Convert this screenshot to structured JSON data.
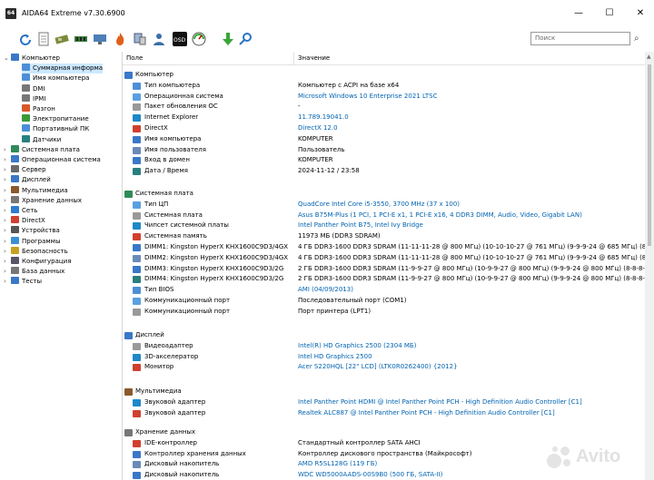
{
  "window": {
    "app_icon": "64",
    "title": "AIDA64 Extreme v7.30.6900",
    "minimize": "—",
    "maximize": "☐",
    "close": "✕"
  },
  "toolbar": {
    "search_placeholder": "Поиск"
  },
  "tree": {
    "items": [
      {
        "label": "Компьютер",
        "expanded": true,
        "level": 0
      },
      {
        "label": "Суммарная информа",
        "selected": true,
        "level": 1
      },
      {
        "label": "Имя компьютера",
        "level": 1
      },
      {
        "label": "DMI",
        "level": 1
      },
      {
        "label": "IPMI",
        "level": 1
      },
      {
        "label": "Разгон",
        "level": 1
      },
      {
        "label": "Электропитание",
        "level": 1
      },
      {
        "label": "Портативный ПК",
        "level": 1
      },
      {
        "label": "Датчики",
        "level": 1
      },
      {
        "label": "Системная плата",
        "level": 0
      },
      {
        "label": "Операционная система",
        "level": 0
      },
      {
        "label": "Сервер",
        "level": 0
      },
      {
        "label": "Дисплей",
        "level": 0
      },
      {
        "label": "Мультимедиа",
        "level": 0
      },
      {
        "label": "Хранение данных",
        "level": 0
      },
      {
        "label": "Сеть",
        "level": 0
      },
      {
        "label": "DirectX",
        "level": 0
      },
      {
        "label": "Устройства",
        "level": 0
      },
      {
        "label": "Программы",
        "level": 0
      },
      {
        "label": "Безопасность",
        "level": 0
      },
      {
        "label": "Конфигурация",
        "level": 0
      },
      {
        "label": "База данных",
        "level": 0
      },
      {
        "label": "Тесты",
        "level": 0
      }
    ]
  },
  "table": {
    "col_field": "Поле",
    "col_value": "Значение",
    "sections": [
      {
        "title": "Компьютер",
        "rows": [
          {
            "field": "Тип компьютера",
            "value": "Компьютер с ACPI на базе x64",
            "link": false
          },
          {
            "field": "Операционная система",
            "value": "Microsoft Windows 10 Enterprise 2021 LTSC",
            "link": true
          },
          {
            "field": "Пакет обновления ОС",
            "value": "-",
            "link": false
          },
          {
            "field": "Internet Explorer",
            "value": "11.789.19041.0",
            "link": true
          },
          {
            "field": "DirectX",
            "value": "DirectX 12.0",
            "link": true
          },
          {
            "field": "Имя компьютера",
            "value": "KOMPUTER",
            "link": false
          },
          {
            "field": "Имя пользователя",
            "value": "Пользователь",
            "link": false
          },
          {
            "field": "Вход в домен",
            "value": "KOMPUTER",
            "link": false
          },
          {
            "field": "Дата / Время",
            "value": "2024-11-12 / 23:58",
            "link": false
          }
        ]
      },
      {
        "title": "Системная плата",
        "rows": [
          {
            "field": "Тип ЦП",
            "value": "QuadCore Intel Core i5-3550, 3700 MHz (37 x 100)",
            "link": true
          },
          {
            "field": "Системная плата",
            "value": "Asus B75M-Plus  (1 PCI, 1 PCI-E x1, 1 PCI-E x16, 4 DDR3 DIMM, Audio, Video, Gigabit LAN)",
            "link": true
          },
          {
            "field": "Чипсет системной платы",
            "value": "Intel Panther Point B75, Intel Ivy Bridge",
            "link": true
          },
          {
            "field": "Системная память",
            "value": "11973 МБ  (DDR3 SDRAM)",
            "link": false
          },
          {
            "field": "DIMM1: Kingston HyperX KHX1600C9D3/4GX",
            "value": "4 ГБ DDR3-1600 DDR3 SDRAM  (11-11-11-28 @ 800 МГц)  (10-10-10-27 @ 761 МГц)  (9-9-9-24 @ 685 МГц)  (8-8-",
            "link": false
          },
          {
            "field": "DIMM2: Kingston HyperX KHX1600C9D3/4GX",
            "value": "4 ГБ DDR3-1600 DDR3 SDRAM  (11-11-11-28 @ 800 МГц)  (10-10-10-27 @ 761 МГц)  (9-9-9-24 @ 685 МГц)  (8-8-",
            "link": false
          },
          {
            "field": "DIMM3: Kingston HyperX KHX1600C9D3/2G",
            "value": "2 ГБ DDR3-1600 DDR3 SDRAM  (11-9-9-27 @ 800 МГц)  (10-9-9-27 @ 800 МГц)  (9-9-9-24 @ 800 МГц)  (8-8-8-2",
            "link": false
          },
          {
            "field": "DIMM4: Kingston HyperX KHX1600C9D3/2G",
            "value": "2 ГБ DDR3-1600 DDR3 SDRAM  (11-9-9-27 @ 800 МГц)  (10-9-9-27 @ 800 МГц)  (9-9-9-24 @ 800 МГц)  (8-8-8-2",
            "link": false
          },
          {
            "field": "Тип BIOS",
            "value": "AMI (04/09/2013)",
            "link": true
          },
          {
            "field": "Коммуникационный порт",
            "value": "Последовательный порт (COM1)",
            "link": false
          },
          {
            "field": "Коммуникационный порт",
            "value": "Порт принтера (LPT1)",
            "link": false
          }
        ]
      },
      {
        "title": "Дисплей",
        "rows": [
          {
            "field": "Видеоадаптер",
            "value": "Intel(R) HD Graphics 2500  (2304 МБ)",
            "link": true
          },
          {
            "field": "3D-акселератор",
            "value": "Intel HD Graphics 2500",
            "link": true
          },
          {
            "field": "Монитор",
            "value": "Acer S220HQL  [22\" LCD]  (LTK0R0262400)  {2012}",
            "link": true
          }
        ]
      },
      {
        "title": "Мультимедиа",
        "rows": [
          {
            "field": "Звуковой адаптер",
            "value": "Intel Panther Point HDMI @ Intel Panther Point PCH - High Definition Audio Controller [C1]",
            "link": true
          },
          {
            "field": "Звуковой адаптер",
            "value": "Realtek ALC887 @ Intel Panther Point PCH - High Definition Audio Controller [C1]",
            "link": true
          }
        ]
      },
      {
        "title": "Хранение данных",
        "rows": [
          {
            "field": "IDE-контроллер",
            "value": "Стандартный контроллер SATA AHCI",
            "link": false
          },
          {
            "field": "Контроллер хранения данных",
            "value": "Контроллер дискового пространства (Майкрософт)",
            "link": false
          },
          {
            "field": "Дисковый накопитель",
            "value": "AMD R5SL128G  (119 ГБ)",
            "link": true
          },
          {
            "field": "Дисковый накопитель",
            "value": "WDC WD5000AADS-00S9B0  (500 ГБ, SATA-II)",
            "link": true
          }
        ]
      }
    ]
  },
  "watermark": {
    "text": "Avito"
  }
}
